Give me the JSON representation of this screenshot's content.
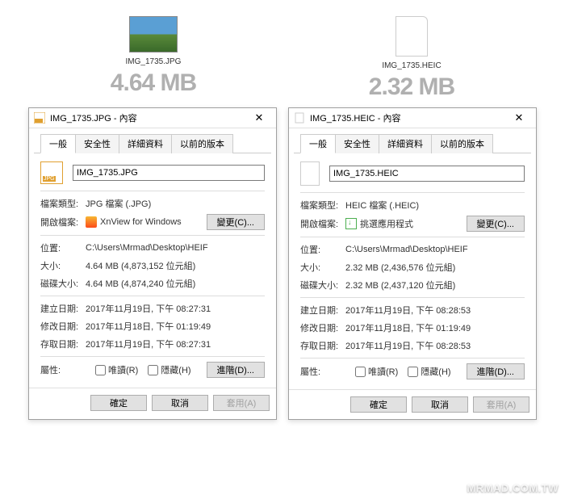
{
  "tabs": [
    "一般",
    "安全性",
    "詳細資料",
    "以前的版本"
  ],
  "labels": {
    "filetype": "檔案類型:",
    "openwith": "開啟檔案:",
    "change": "變更(C)...",
    "location": "位置:",
    "size": "大小:",
    "disksize": "磁碟大小:",
    "created": "建立日期:",
    "modified": "修改日期:",
    "accessed": "存取日期:",
    "attributes": "屬性:",
    "readonly": "唯讀(R)",
    "hidden": "隱藏(H)",
    "advanced": "進階(D)...",
    "ok": "確定",
    "cancel": "取消",
    "apply": "套用(A)"
  },
  "left": {
    "thumbname": "IMG_1735.JPG",
    "bigsize": "4.64 MB",
    "title": "IMG_1735.JPG - 內容",
    "filename": "IMG_1735.JPG",
    "filetype": "JPG 檔案 (.JPG)",
    "openwith": "XnView for Windows",
    "location": "C:\\Users\\Mrmad\\Desktop\\HEIF",
    "size": "4.64 MB (4,873,152 位元組)",
    "disksize": "4.64 MB (4,874,240 位元組)",
    "created": "2017年11月19日, 下午 08:27:31",
    "modified": "2017年11月18日, 下午 01:19:49",
    "accessed": "2017年11月19日, 下午 08:27:31"
  },
  "right": {
    "thumbname": "IMG_1735.HEIC",
    "bigsize": "2.32 MB",
    "title": "IMG_1735.HEIC - 內容",
    "filename": "IMG_1735.HEIC",
    "filetype": "HEIC 檔案 (.HEIC)",
    "openwith": "挑選應用程式",
    "location": "C:\\Users\\Mrmad\\Desktop\\HEIF",
    "size": "2.32 MB (2,436,576 位元組)",
    "disksize": "2.32 MB (2,437,120 位元組)",
    "created": "2017年11月19日, 下午 08:28:53",
    "modified": "2017年11月18日, 下午 01:19:49",
    "accessed": "2017年11月19日, 下午 08:28:53"
  },
  "watermark": "MRMAD.COM.TW"
}
